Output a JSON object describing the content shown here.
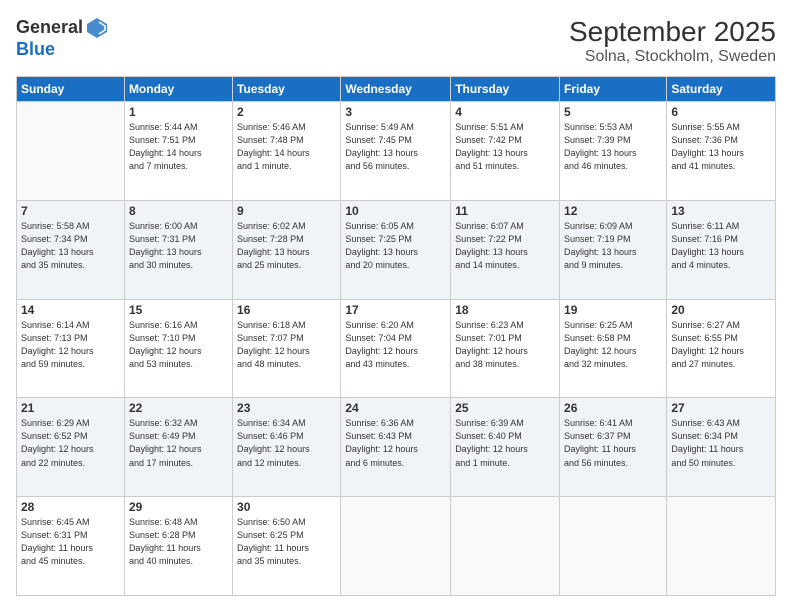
{
  "header": {
    "logo_general": "General",
    "logo_blue": "Blue",
    "month": "September 2025",
    "location": "Solna, Stockholm, Sweden"
  },
  "days_of_week": [
    "Sunday",
    "Monday",
    "Tuesday",
    "Wednesday",
    "Thursday",
    "Friday",
    "Saturday"
  ],
  "weeks": [
    [
      {
        "day": "",
        "info": ""
      },
      {
        "day": "1",
        "info": "Sunrise: 5:44 AM\nSunset: 7:51 PM\nDaylight: 14 hours\nand 7 minutes."
      },
      {
        "day": "2",
        "info": "Sunrise: 5:46 AM\nSunset: 7:48 PM\nDaylight: 14 hours\nand 1 minute."
      },
      {
        "day": "3",
        "info": "Sunrise: 5:49 AM\nSunset: 7:45 PM\nDaylight: 13 hours\nand 56 minutes."
      },
      {
        "day": "4",
        "info": "Sunrise: 5:51 AM\nSunset: 7:42 PM\nDaylight: 13 hours\nand 51 minutes."
      },
      {
        "day": "5",
        "info": "Sunrise: 5:53 AM\nSunset: 7:39 PM\nDaylight: 13 hours\nand 46 minutes."
      },
      {
        "day": "6",
        "info": "Sunrise: 5:55 AM\nSunset: 7:36 PM\nDaylight: 13 hours\nand 41 minutes."
      }
    ],
    [
      {
        "day": "7",
        "info": "Sunrise: 5:58 AM\nSunset: 7:34 PM\nDaylight: 13 hours\nand 35 minutes."
      },
      {
        "day": "8",
        "info": "Sunrise: 6:00 AM\nSunset: 7:31 PM\nDaylight: 13 hours\nand 30 minutes."
      },
      {
        "day": "9",
        "info": "Sunrise: 6:02 AM\nSunset: 7:28 PM\nDaylight: 13 hours\nand 25 minutes."
      },
      {
        "day": "10",
        "info": "Sunrise: 6:05 AM\nSunset: 7:25 PM\nDaylight: 13 hours\nand 20 minutes."
      },
      {
        "day": "11",
        "info": "Sunrise: 6:07 AM\nSunset: 7:22 PM\nDaylight: 13 hours\nand 14 minutes."
      },
      {
        "day": "12",
        "info": "Sunrise: 6:09 AM\nSunset: 7:19 PM\nDaylight: 13 hours\nand 9 minutes."
      },
      {
        "day": "13",
        "info": "Sunrise: 6:11 AM\nSunset: 7:16 PM\nDaylight: 13 hours\nand 4 minutes."
      }
    ],
    [
      {
        "day": "14",
        "info": "Sunrise: 6:14 AM\nSunset: 7:13 PM\nDaylight: 12 hours\nand 59 minutes."
      },
      {
        "day": "15",
        "info": "Sunrise: 6:16 AM\nSunset: 7:10 PM\nDaylight: 12 hours\nand 53 minutes."
      },
      {
        "day": "16",
        "info": "Sunrise: 6:18 AM\nSunset: 7:07 PM\nDaylight: 12 hours\nand 48 minutes."
      },
      {
        "day": "17",
        "info": "Sunrise: 6:20 AM\nSunset: 7:04 PM\nDaylight: 12 hours\nand 43 minutes."
      },
      {
        "day": "18",
        "info": "Sunrise: 6:23 AM\nSunset: 7:01 PM\nDaylight: 12 hours\nand 38 minutes."
      },
      {
        "day": "19",
        "info": "Sunrise: 6:25 AM\nSunset: 6:58 PM\nDaylight: 12 hours\nand 32 minutes."
      },
      {
        "day": "20",
        "info": "Sunrise: 6:27 AM\nSunset: 6:55 PM\nDaylight: 12 hours\nand 27 minutes."
      }
    ],
    [
      {
        "day": "21",
        "info": "Sunrise: 6:29 AM\nSunset: 6:52 PM\nDaylight: 12 hours\nand 22 minutes."
      },
      {
        "day": "22",
        "info": "Sunrise: 6:32 AM\nSunset: 6:49 PM\nDaylight: 12 hours\nand 17 minutes."
      },
      {
        "day": "23",
        "info": "Sunrise: 6:34 AM\nSunset: 6:46 PM\nDaylight: 12 hours\nand 12 minutes."
      },
      {
        "day": "24",
        "info": "Sunrise: 6:36 AM\nSunset: 6:43 PM\nDaylight: 12 hours\nand 6 minutes."
      },
      {
        "day": "25",
        "info": "Sunrise: 6:39 AM\nSunset: 6:40 PM\nDaylight: 12 hours\nand 1 minute."
      },
      {
        "day": "26",
        "info": "Sunrise: 6:41 AM\nSunset: 6:37 PM\nDaylight: 11 hours\nand 56 minutes."
      },
      {
        "day": "27",
        "info": "Sunrise: 6:43 AM\nSunset: 6:34 PM\nDaylight: 11 hours\nand 50 minutes."
      }
    ],
    [
      {
        "day": "28",
        "info": "Sunrise: 6:45 AM\nSunset: 6:31 PM\nDaylight: 11 hours\nand 45 minutes."
      },
      {
        "day": "29",
        "info": "Sunrise: 6:48 AM\nSunset: 6:28 PM\nDaylight: 11 hours\nand 40 minutes."
      },
      {
        "day": "30",
        "info": "Sunrise: 6:50 AM\nSunset: 6:25 PM\nDaylight: 11 hours\nand 35 minutes."
      },
      {
        "day": "",
        "info": ""
      },
      {
        "day": "",
        "info": ""
      },
      {
        "day": "",
        "info": ""
      },
      {
        "day": "",
        "info": ""
      }
    ]
  ]
}
